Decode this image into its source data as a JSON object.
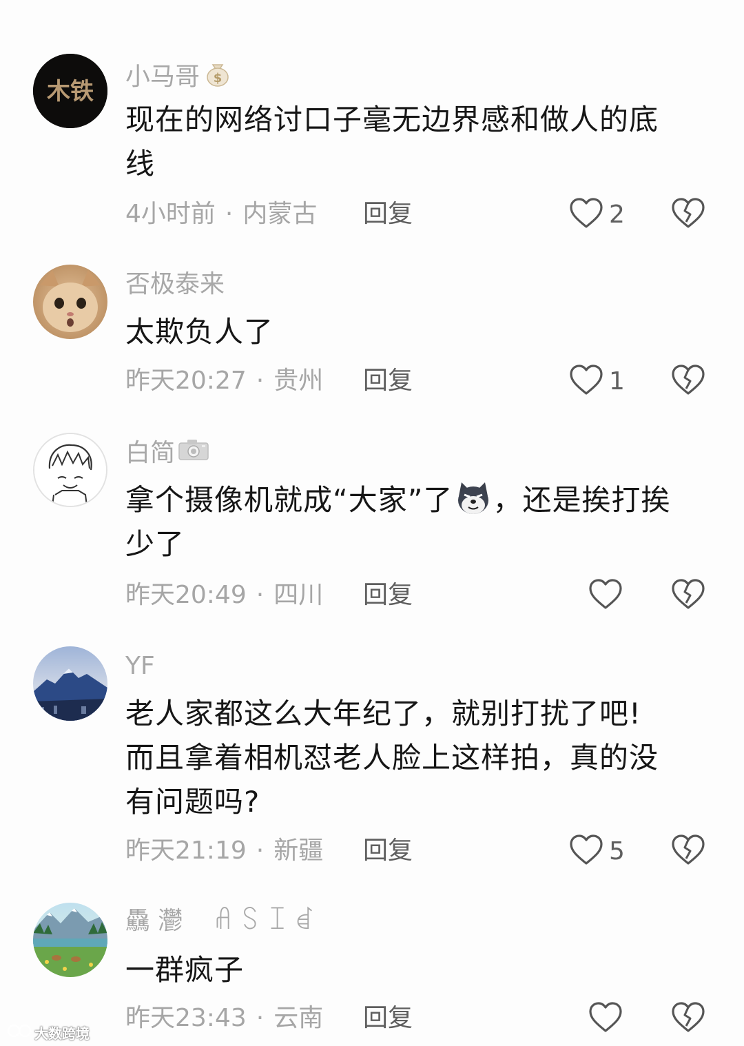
{
  "comments": [
    {
      "username": "小马哥",
      "badge": "money-bag-icon",
      "content_lines": [
        "现在的网络讨口子毫无边界感和做人的底",
        "线"
      ],
      "time": "4小时前",
      "location": "内蒙古",
      "reply": "回复",
      "likes": "2"
    },
    {
      "username": "否极泰来",
      "content_lines": [
        "太欺负人了"
      ],
      "time": "昨天20:27",
      "location": "贵州",
      "reply": "回复",
      "likes": "1"
    },
    {
      "username": "白简",
      "badge": "camera-icon",
      "content_part1": "拿个摄像机就成“大家”了",
      "content_emoji": "doge-icon",
      "content_part2": "，还是挨打挨",
      "content_line2": "少了",
      "time": "昨天20:49",
      "location": "四川",
      "reply": "回复",
      "likes": ""
    },
    {
      "username": "YF",
      "content_lines": [
        "老人家都这么大年纪了，就别打扰了吧!",
        "而且拿着相机怼老人脸上这样拍，真的没",
        "有问题吗?"
      ],
      "time": "昨天21:19",
      "location": "新疆",
      "reply": "回复",
      "likes": "5"
    },
    {
      "username": "驫 灪",
      "username_suffix": "ꋬ ꇙ ꀤ ꀸ",
      "content_lines": [
        "一群疯子"
      ],
      "time": "昨天23:43",
      "location": "云南",
      "reply": "回复",
      "likes": ""
    }
  ],
  "avatar1_text": "木铁",
  "separator": "·",
  "watermark": "大数跨境"
}
